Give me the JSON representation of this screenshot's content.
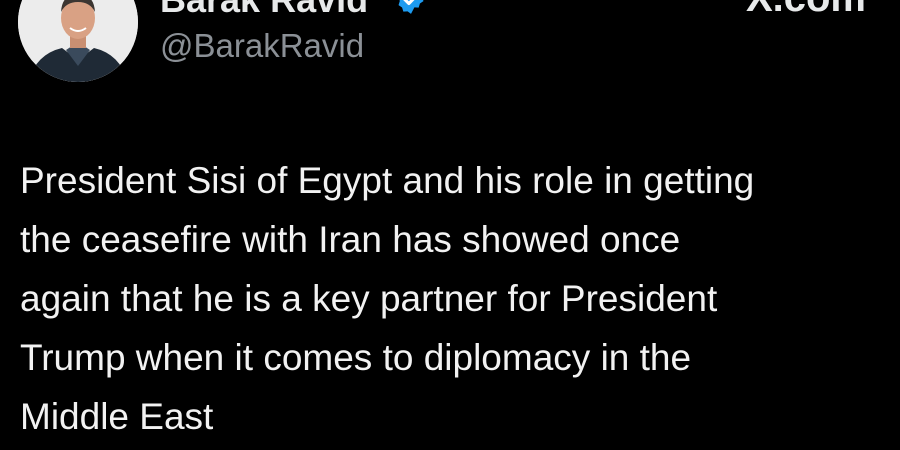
{
  "author": {
    "display_name": "Barak Ravid",
    "handle": "@BarakRavid",
    "verified": true,
    "avatar_icon": "avatar-photo"
  },
  "source": {
    "label": "X.com"
  },
  "tweet": {
    "lines": [
      "President Sisi of Egypt and his role in getting",
      "the ceasefire with Iran has showed once",
      "again that he is a key partner for President",
      "Trump when it comes to diplomacy in the",
      "Middle East"
    ]
  },
  "colors": {
    "background": "#000000",
    "text": "#e7e9ea",
    "secondary_text": "#8b9096",
    "verified_blue": "#1d9bf0"
  }
}
